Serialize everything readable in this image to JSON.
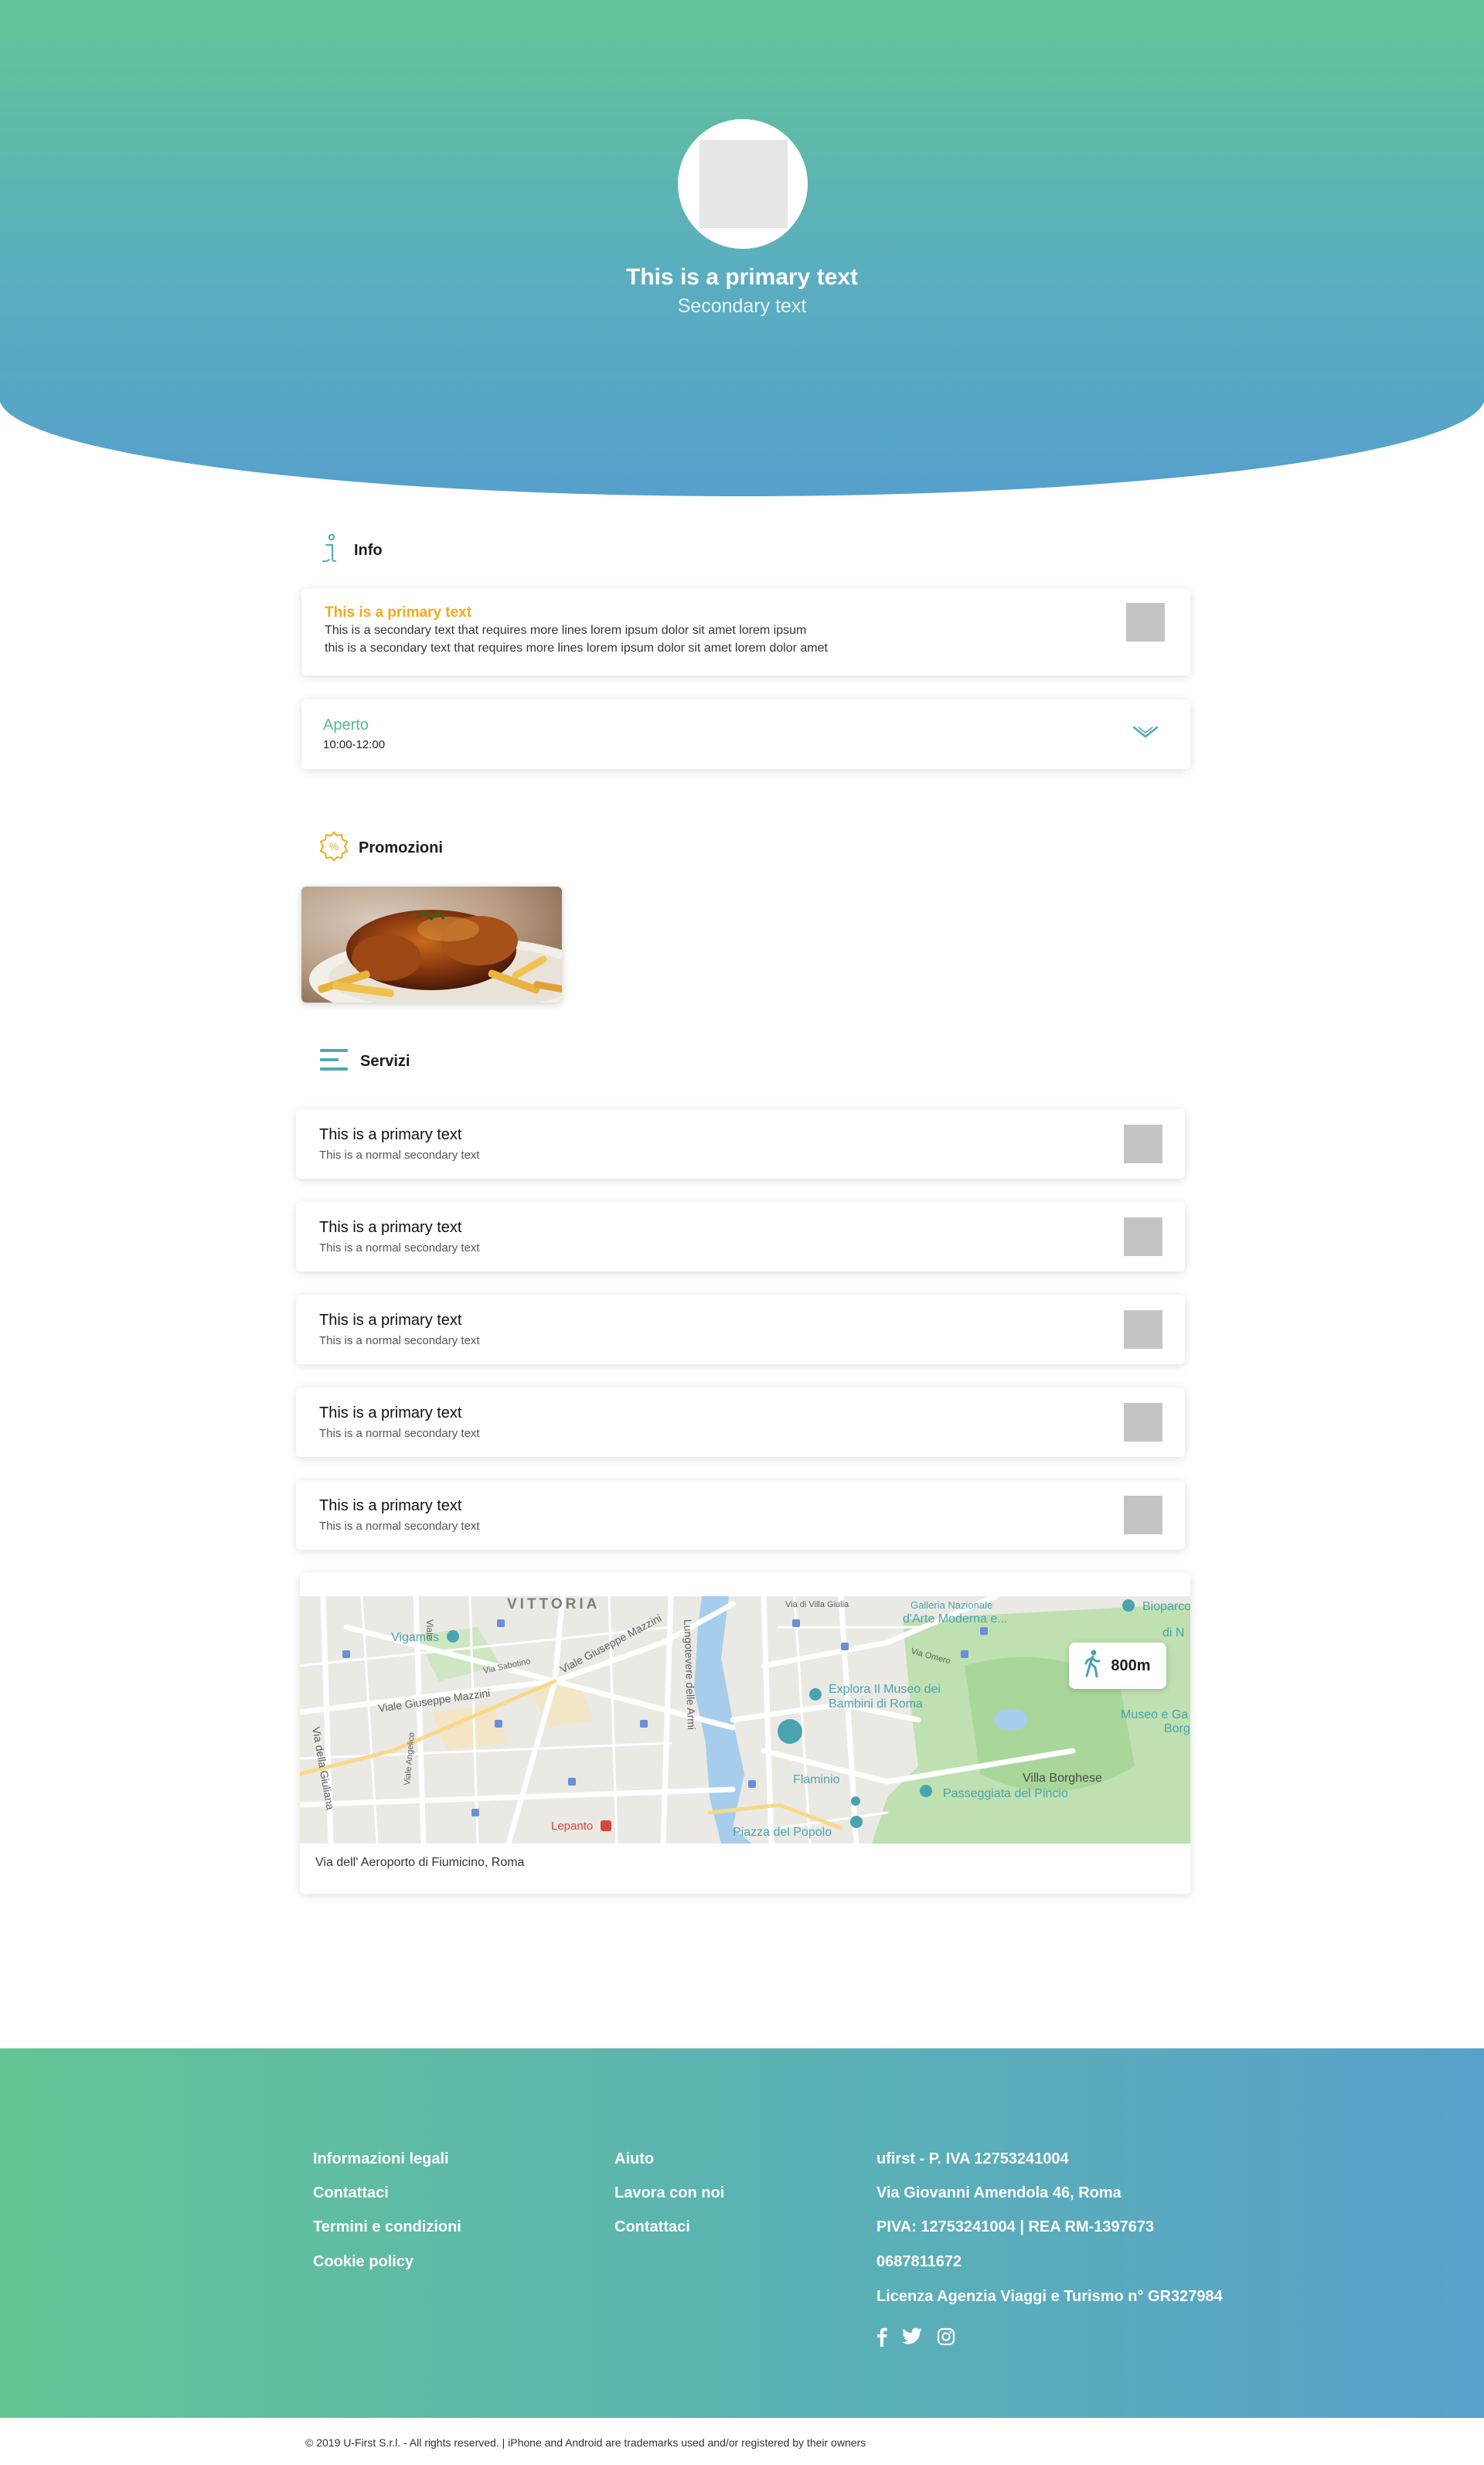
{
  "header": {
    "title": "This is a primary text",
    "subtitle": "Secondary text"
  },
  "info": {
    "heading": "Info",
    "card": {
      "title": "This is a primary text",
      "lines": [
        "This is a secondary text that requires more lines lorem ipsum dolor sit amet lorem ipsum",
        "this is a secondary text that requires more lines lorem ipsum dolor sit amet lorem dolor amet"
      ]
    },
    "hours": {
      "status": "Aperto",
      "time": "10:00-12:00"
    }
  },
  "promotions": {
    "heading": "Promozioni",
    "items": [
      {
        "image": "roast-chicken-photo"
      }
    ]
  },
  "services": {
    "heading": "Servizi",
    "items": [
      {
        "title": "This is a primary text",
        "subtitle": "This is a normal secondary text"
      },
      {
        "title": "This is a primary text",
        "subtitle": "This is a normal secondary text"
      },
      {
        "title": "This is a primary text",
        "subtitle": "This is a normal secondary text"
      },
      {
        "title": "This is a primary text",
        "subtitle": "This is a normal secondary text"
      },
      {
        "title": "This is a primary text",
        "subtitle": "This is a normal secondary text"
      }
    ]
  },
  "map": {
    "distance": "800m",
    "address": "Via dell' Aeroporto di Fiumicino, Roma",
    "labels": {
      "vittoria": "VITTORIA",
      "vigamus": "Vigamus",
      "mazzini1": "Viale Giuseppe Mazzini",
      "mazzini2": "Viale Giuseppe Mazzini",
      "sabotino": "Via Sabotino",
      "giuliana": "Via della Giuliana",
      "angelico": "Viale Angelico",
      "viale": "Viale",
      "lungotevere": "Lungotevere delle Armi",
      "villagiulia": "Via di Villa Giulia",
      "artemoderna": "d'Arte Moderna e...",
      "bioparco": "Bioparco",
      "explora": "Explora Il Museo dei",
      "bambini": "Bambini di Roma",
      "flaminio": "Flaminio",
      "lepanto": "Lepanto",
      "popolo": "Piazza del Popolo",
      "borghese": "Villa Borghese",
      "pincio": "Passeggiata del Pincio",
      "museo": "Museo e Ga",
      "borg": "Borg",
      "din": "di N",
      "omero": "Via Omero",
      "galleria": "Galleria Nazionale"
    }
  },
  "footer": {
    "col1": [
      "Informazioni legali",
      "Contattaci",
      "Termini e condizioni",
      "Cookie policy"
    ],
    "col2": [
      "Aiuto",
      "Lavora con noi",
      "Contattaci"
    ],
    "col3": [
      "ufirst - P. IVA 12753241004",
      "Via Giovanni Amendola 46, Roma",
      "PIVA: 12753241004 | REA RM-1397673",
      "0687811672",
      "Licenza Agenzia Viaggi e Turismo n° GR327984"
    ],
    "social": [
      "facebook-icon",
      "twitter-icon",
      "instagram-icon"
    ],
    "copyright": "© 2019 U-First S.r.l. - All rights reserved. | iPhone and Android are trademarks used and/or registered by their owners"
  },
  "colors": {
    "gradient_start": "#62c494",
    "gradient_end": "#56a0cc",
    "accent_orange": "#f1aa1d",
    "accent_green": "#55bb8c",
    "accent_teal": "#4fa9b4"
  }
}
